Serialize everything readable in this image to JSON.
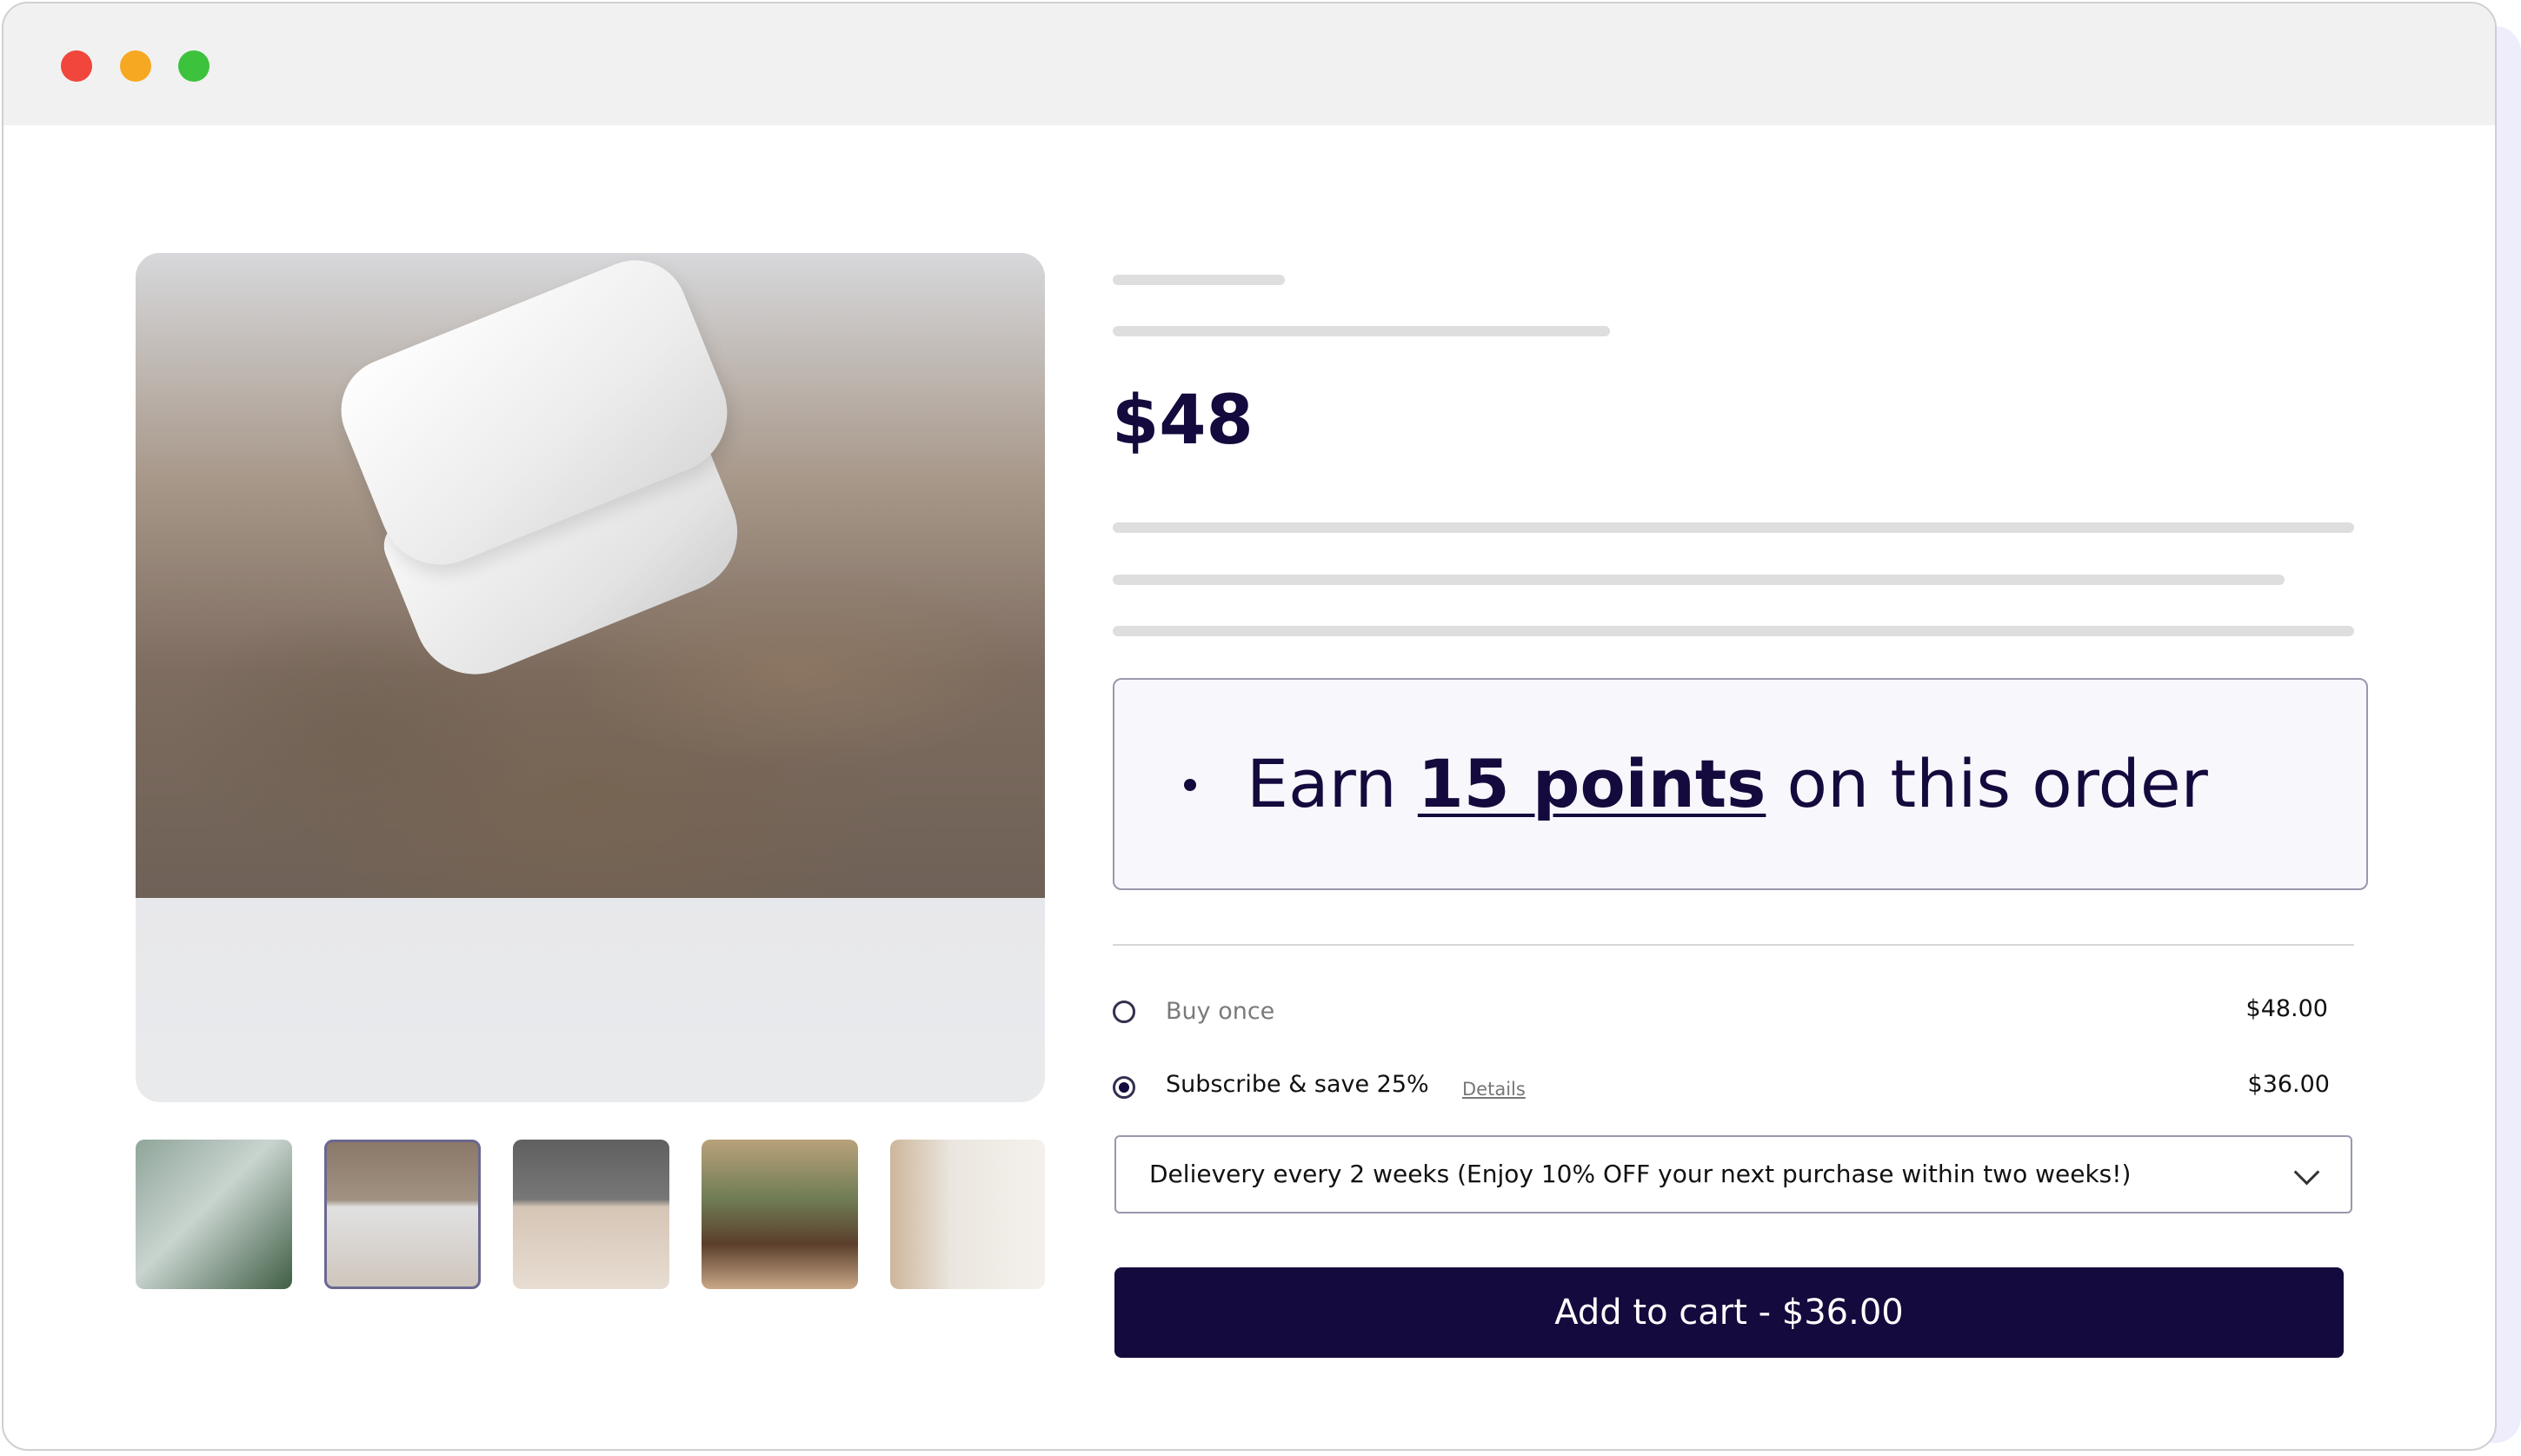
{
  "window": {
    "controls": [
      "close",
      "minimize",
      "maximize"
    ]
  },
  "gallery": {
    "main_image": "skincare-jar-on-bark",
    "thumbnails": [
      "leaves-product",
      "jar-on-bark",
      "jar-on-stone",
      "plant-on-bark",
      "woman-vanity"
    ],
    "selected_thumbnail": 1
  },
  "product": {
    "price": "$48"
  },
  "rewards": {
    "prefix": "Earn ",
    "points_link": "15 points",
    "suffix": " on this order"
  },
  "purchase_options": {
    "buy_once": {
      "label": "Buy once",
      "price": "$48.00",
      "selected": false
    },
    "subscribe": {
      "label": "Subscribe & save 25%",
      "details_link": "Details",
      "price": "$36.00",
      "selected": true
    }
  },
  "delivery_select": {
    "value": "Delievery every 2 weeks (Enjoy 10% OFF your next purchase within two weeks!)"
  },
  "cart_button": {
    "label": "Add to cart - $36.00"
  },
  "colors": {
    "brand": "#150a3d",
    "rewards_bg": "#f8f7fc",
    "skeleton": "#dedede"
  }
}
